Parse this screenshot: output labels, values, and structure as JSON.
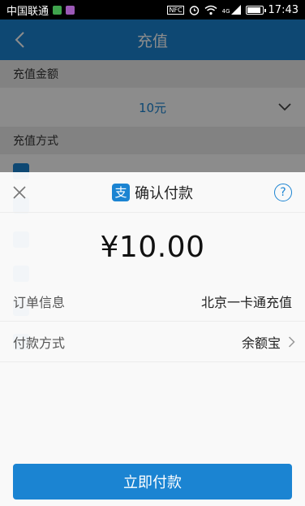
{
  "status_bar": {
    "carrier": "中国联通",
    "time": "17:43",
    "network": "4G",
    "nfc": "NFC",
    "battery_level": 0.9
  },
  "nav": {
    "title": "充值",
    "back_icon": "chevron-left-icon"
  },
  "background": {
    "amount_section_label": "充值金额",
    "amount_value": "10元",
    "method_section_label": "充值方式"
  },
  "sheet": {
    "title": "确认付款",
    "logo_glyph": "支",
    "help_glyph": "?",
    "price": "¥10.00",
    "rows": [
      {
        "label": "订单信息",
        "value": "北京一卡通充值"
      },
      {
        "label": "付款方式",
        "value": "余额宝"
      }
    ],
    "pay_button_label": "立即付款"
  },
  "colors": {
    "accent": "#1b84d2",
    "status_bar": "#000000"
  }
}
